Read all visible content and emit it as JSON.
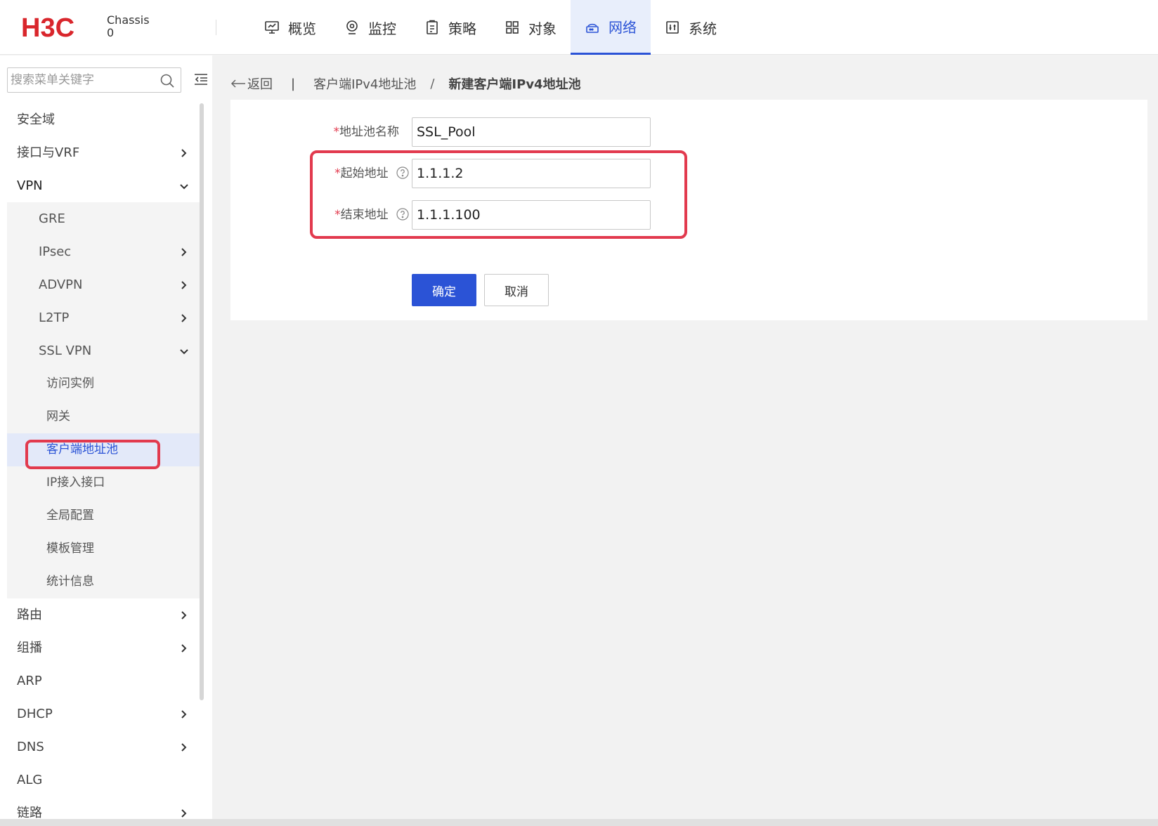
{
  "header": {
    "logo_text": "H3C",
    "chassis_label": "Chassis",
    "chassis_value": "0",
    "nav": [
      {
        "label": "概览",
        "icon": "monitor-icon",
        "active": false
      },
      {
        "label": "监控",
        "icon": "location-pin-icon",
        "active": false
      },
      {
        "label": "策略",
        "icon": "clipboard-icon",
        "active": false
      },
      {
        "label": "对象",
        "icon": "grid-icon",
        "active": false
      },
      {
        "label": "网络",
        "icon": "network-icon",
        "active": true
      },
      {
        "label": "系统",
        "icon": "system-settings-icon",
        "active": false
      }
    ]
  },
  "sidebar": {
    "search_placeholder": "搜索菜单关键字",
    "items": [
      {
        "label": "安全域"
      },
      {
        "label": "接口与VRF"
      },
      {
        "label": "VPN"
      },
      {
        "label": "GRE"
      },
      {
        "label": "IPsec"
      },
      {
        "label": "ADVPN"
      },
      {
        "label": "L2TP"
      },
      {
        "label": "SSL VPN"
      },
      {
        "label": "访问实例"
      },
      {
        "label": "网关"
      },
      {
        "label": "客户端地址池"
      },
      {
        "label": "IP接入接口"
      },
      {
        "label": "全局配置"
      },
      {
        "label": "模板管理"
      },
      {
        "label": "统计信息"
      },
      {
        "label": "路由"
      },
      {
        "label": "组播"
      },
      {
        "label": "ARP"
      },
      {
        "label": "DHCP"
      },
      {
        "label": "DNS"
      },
      {
        "label": "ALG"
      },
      {
        "label": "链路"
      }
    ]
  },
  "breadcrumb": {
    "back": "返回",
    "separator": "|",
    "parent": "客户端IPv4地址池",
    "slash": "/",
    "current": "新建客户端IPv4地址池"
  },
  "form": {
    "required_mark": "*",
    "pool_name_label": "地址池名称",
    "pool_name_value": "SSL_Pool",
    "start_label": "起始地址",
    "start_value": "1.1.1.2",
    "end_label": "结束地址",
    "end_value": "1.1.1.100",
    "ok_label": "确定",
    "cancel_label": "取消"
  },
  "colors": {
    "accent": "#2b53d6",
    "highlight": "#e23a4e",
    "logo": "#d9262c"
  }
}
